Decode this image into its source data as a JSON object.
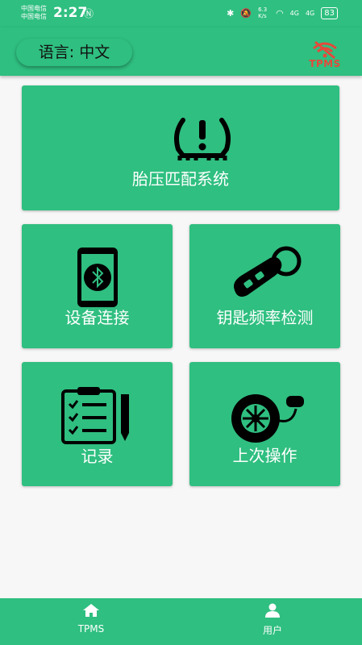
{
  "status_bar": {
    "carrier1": "中国电信",
    "carrier2": "中国电信",
    "time": "2:27",
    "network_speed": "6.3 K/s",
    "signal1": "4G",
    "signal2": "4G",
    "battery": "83"
  },
  "header": {
    "language_label": "语言:  中文",
    "logo_text": "TPMS"
  },
  "tiles": {
    "tire_match": "胎压匹配系统",
    "device_connect": "设备连接",
    "key_frequency": "钥匙频率检测",
    "records": "记录",
    "last_operation": "上次操作"
  },
  "bottom_nav": {
    "tpms": "TPMS",
    "user": "用户"
  },
  "colors": {
    "accent": "#2fbf80",
    "logo": "#e34a3b"
  }
}
